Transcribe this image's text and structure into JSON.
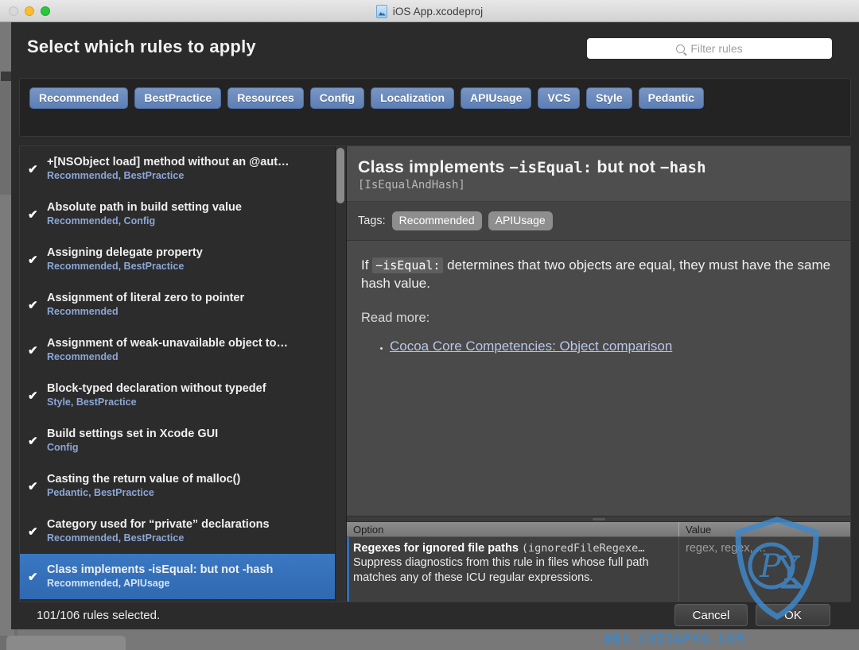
{
  "window": {
    "title": "iOS App.xcodeproj",
    "doc_icon": "xcode-project-icon",
    "traffic_lights": [
      "close",
      "minimize",
      "maximize"
    ]
  },
  "header": {
    "title": "Select which rules to apply",
    "search": {
      "icon": "search-icon",
      "placeholder": "Filter rules",
      "value": ""
    }
  },
  "tag_filters": [
    {
      "label": "Recommended"
    },
    {
      "label": "BestPractice"
    },
    {
      "label": "Resources"
    },
    {
      "label": "Config"
    },
    {
      "label": "Localization"
    },
    {
      "label": "APIUsage"
    },
    {
      "label": "VCS"
    },
    {
      "label": "Style"
    },
    {
      "label": "Pedantic"
    }
  ],
  "rule_list": {
    "check_glyph": "✔",
    "items": [
      {
        "name": "+[NSObject load] method without an @aut…",
        "tags": "Recommended, BestPractice",
        "checked": true,
        "selected": false
      },
      {
        "name": "Absolute path in build setting value",
        "tags": "Recommended, Config",
        "checked": true,
        "selected": false
      },
      {
        "name": "Assigning delegate property",
        "tags": "Recommended, BestPractice",
        "checked": true,
        "selected": false
      },
      {
        "name": "Assignment of literal zero to pointer",
        "tags": "Recommended",
        "checked": true,
        "selected": false
      },
      {
        "name": "Assignment of weak-unavailable object to…",
        "tags": "Recommended",
        "checked": true,
        "selected": false
      },
      {
        "name": "Block-typed declaration without typedef",
        "tags": "Style, BestPractice",
        "checked": true,
        "selected": false
      },
      {
        "name": "Build settings set in Xcode GUI",
        "tags": "Config",
        "checked": true,
        "selected": false
      },
      {
        "name": "Casting the return value of malloc()",
        "tags": "Pedantic, BestPractice",
        "checked": true,
        "selected": false
      },
      {
        "name": "Category used for “private” declarations",
        "tags": "Recommended, BestPractice",
        "checked": true,
        "selected": false
      },
      {
        "name": "Class implements -isEqual: but not -hash",
        "tags": "Recommended, APIUsage",
        "checked": true,
        "selected": true
      }
    ]
  },
  "detail": {
    "title_part1": "Class implements ",
    "title_code1": "−isEqual:",
    "title_part2": " but not ",
    "title_code2": "−hash",
    "identifier": "[IsEqualAndHash]",
    "tags_label": "Tags:",
    "tags": [
      "Recommended",
      "APIUsage"
    ],
    "body_prefix": "If ",
    "body_code": "−isEqual:",
    "body_suffix": " determines that two objects are equal, they must have the same hash value.",
    "read_more_label": "Read more:",
    "links": [
      {
        "text": "Cocoa Core Competencies: Object comparison"
      }
    ]
  },
  "options_table": {
    "columns": {
      "option": "Option",
      "value": "Value"
    },
    "rows": [
      {
        "title": "Regexes for ignored file paths",
        "key": "(ignoredFileRegexe…",
        "description": "Suppress diagnostics from this rule in files whose full path matches any of these ICU regular expressions.",
        "value": "regex, regex, ..."
      }
    ]
  },
  "footer": {
    "status": "101/106 rules selected.",
    "cancel_label": "Cancel",
    "ok_label": "OK"
  },
  "watermark": {
    "text": "BBS.CHINAPYG.COM",
    "color": "#3f87c8",
    "shield_label": "PYG"
  }
}
